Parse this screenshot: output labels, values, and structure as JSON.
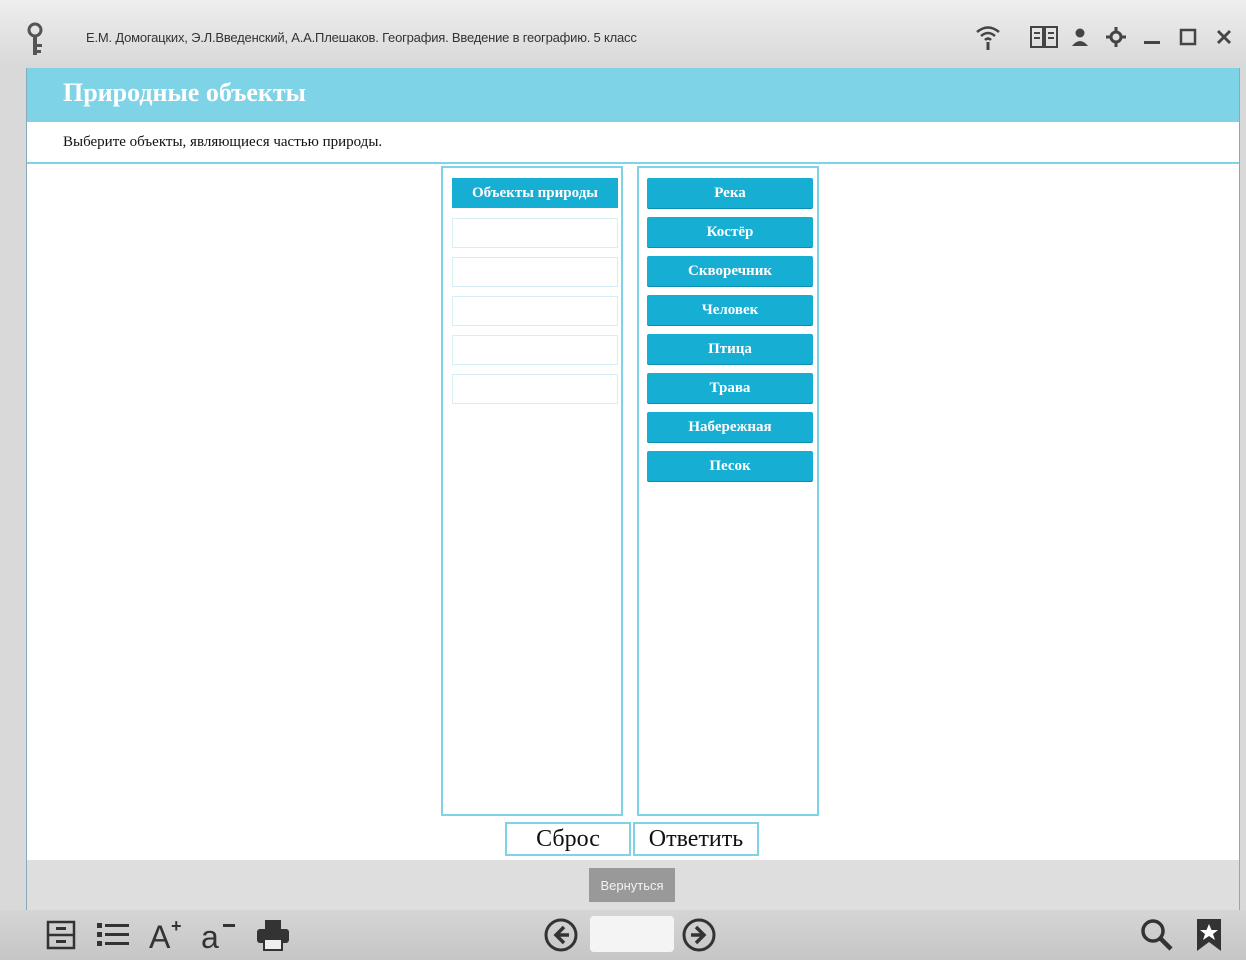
{
  "titlebar": {
    "app_title": "Е.М. Домогацких, Э.Л.Введенский, А.А.Плешаков. География. Введение в географию. 5 класс",
    "icons": [
      "key-icon",
      "wifi-icon",
      "book-icon",
      "user-icon",
      "settings-icon",
      "minimize-icon",
      "maximize-icon",
      "close-icon"
    ]
  },
  "lesson": {
    "title": "Природные объекты",
    "instruction": "Выберите объекты, являющиеся частью природы."
  },
  "target_column": {
    "header": "Объекты природы",
    "slots": [
      "",
      "",
      "",
      "",
      ""
    ]
  },
  "source_column": {
    "items": [
      "Река",
      "Костёр",
      "Скворечник",
      "Человек",
      "Птица",
      "Трава",
      "Набережная",
      "Песок"
    ]
  },
  "buttons": {
    "reset": "Сброс",
    "answer": "Ответить",
    "back": "Вернуться"
  },
  "toolbar": {
    "icons": [
      "contents-icon",
      "list-icon",
      "font-increase-icon",
      "font-decrease-icon",
      "print-icon",
      "prev-page-icon",
      "next-page-icon",
      "search-icon",
      "bookmark-icon"
    ],
    "page_value": ""
  },
  "colors": {
    "accent": "#17aed4",
    "header": "#7fd3e6"
  }
}
